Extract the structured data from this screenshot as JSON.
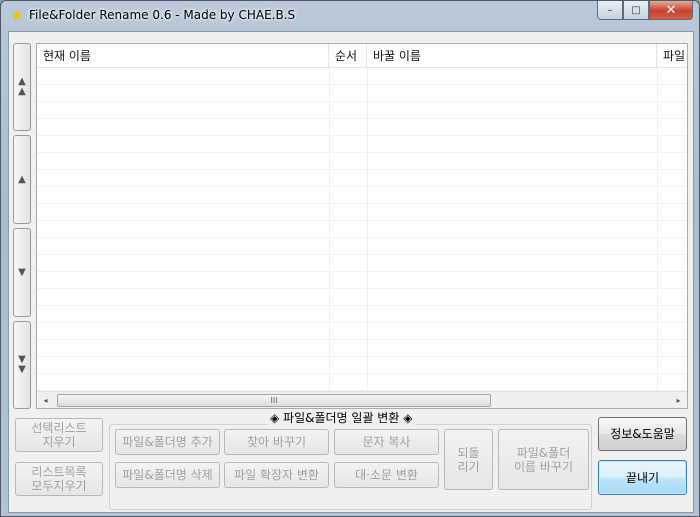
{
  "window": {
    "title": "File&Folder Rename 0.6 - Made by CHAE.B.S",
    "icon": "star-icon",
    "caption": {
      "minimize": "–",
      "maximize": "□",
      "close": "✕"
    }
  },
  "side_buttons": {
    "top": "▲▲",
    "up": "▲",
    "down": "▼",
    "bottom": "▼▼"
  },
  "list": {
    "columns": [
      "현재 이름",
      "순서",
      "바꿀 이름",
      "파일"
    ],
    "rows": [],
    "hscroll_thumb": "III",
    "hscroll_left": "◂",
    "hscroll_right": "▸"
  },
  "left_buttons": {
    "clear_selected": "선택리스트\n지우기",
    "clear_all": "리스트목록\n모두지우기"
  },
  "group": {
    "title": "◈ 파일&폴더명 일괄 변환 ◈",
    "add": "파일&폴더명 추가",
    "delete": "파일&폴더명 삭제",
    "find_replace": "찾아 바꾸기",
    "ext_change": "파일 확장자 변환",
    "copy_text": "문자 복사",
    "case_change": "대·소문 변환",
    "undo": "되돌\n리기",
    "rename": "파일&폴더\n이름 바꾸기"
  },
  "right_buttons": {
    "info_help": "정보&도움말",
    "exit": "끝내기"
  }
}
